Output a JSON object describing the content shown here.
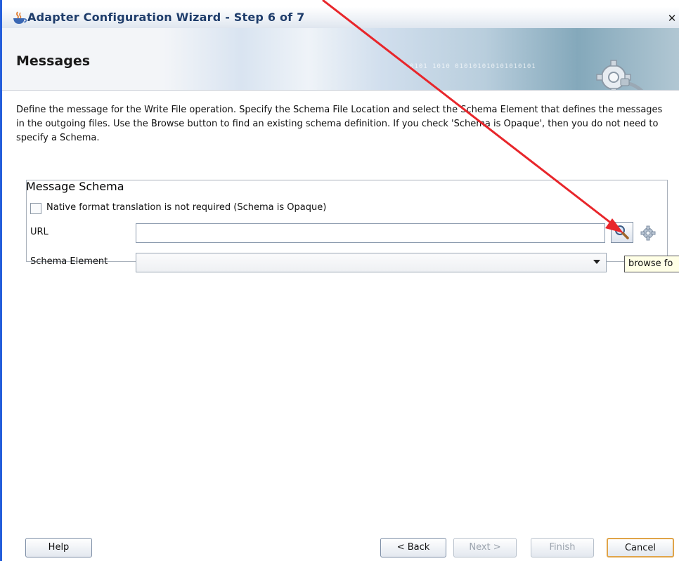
{
  "window": {
    "title": "Adapter Configuration Wizard - Step 6 of 7",
    "close_label": "✕"
  },
  "header": {
    "title": "Messages",
    "binary_text": "0101 1010 010101010101010101"
  },
  "description": "Define the message for the Write File operation.  Specify the Schema File Location and select the Schema Element that defines the messages in the outgoing files. Use the Browse button to find an existing schema definition. If you check 'Schema is Opaque', then you do not need to specify a Schema.",
  "message_schema": {
    "legend": "Message Schema",
    "opaque_checkbox": {
      "label": "Native format translation is not required (Schema is Opaque)",
      "checked": false
    },
    "url": {
      "label": "URL",
      "value": ""
    },
    "schema_element": {
      "label": "Schema Element",
      "value": ""
    },
    "tooltip": "browse fo"
  },
  "buttons": {
    "help": "Help",
    "back": "< Back",
    "next": "Next >",
    "finish": "Finish",
    "cancel": "Cancel"
  },
  "colors": {
    "annotation_arrow": "#e8262b",
    "legend_text": "#3d6ab7",
    "default_button_border": "#e0a449"
  }
}
